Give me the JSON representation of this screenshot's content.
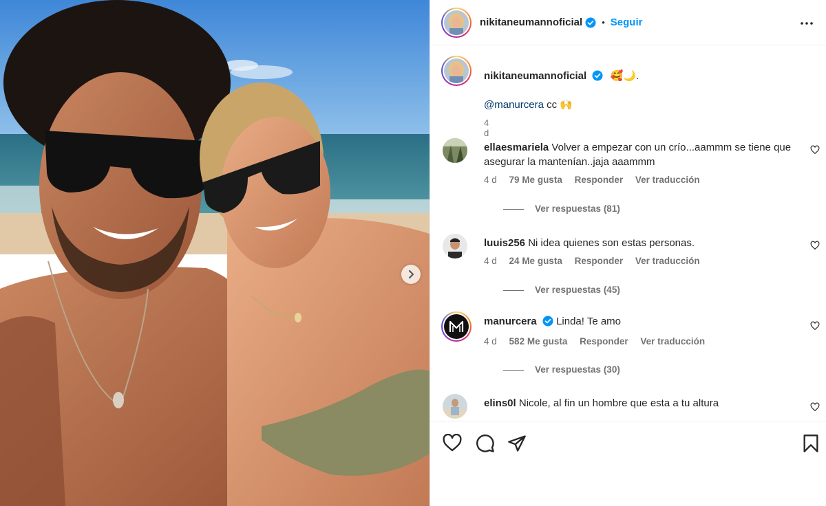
{
  "post": {
    "author": "nikitaneumannoficial",
    "follow_label": "Seguir",
    "separator": "•",
    "caption_emoji": "🥰🌙.",
    "mention": "@manurcera",
    "mention_suffix": " cc 🙌",
    "time": "4 d"
  },
  "comments": [
    {
      "user": "ellaesmariela",
      "text": "Volver a empezar con un crío...aammm se tiene que asegurar la mantenían..jaja aaammm",
      "time": "4 d",
      "likes": "79 Me gusta",
      "reply": "Responder",
      "translate": "Ver traducción",
      "view_replies": "Ver respuestas (81)"
    },
    {
      "user": "luuis256",
      "text": "Ni idea quienes son estas personas.",
      "time": "4 d",
      "likes": "24 Me gusta",
      "reply": "Responder",
      "translate": "Ver traducción",
      "view_replies": "Ver respuestas (45)"
    },
    {
      "user": "manurcera",
      "text": "Linda! Te amo",
      "time": "4 d",
      "likes": "582 Me gusta",
      "reply": "Responder",
      "translate": "Ver traducción",
      "view_replies": "Ver respuestas (30)"
    },
    {
      "user": "elins0l",
      "text": "Nicole, al fin un hombre que esta a tu altura"
    }
  ],
  "icons": {
    "verified": "verified-badge-icon",
    "more": "more-options-icon",
    "like": "heart-icon",
    "comment": "comment-icon",
    "share": "share-icon",
    "save": "bookmark-icon",
    "next": "chevron-right-icon"
  },
  "colors": {
    "accent": "#0095f6",
    "mention": "#00376b",
    "muted": "#737373",
    "text": "#262626"
  }
}
